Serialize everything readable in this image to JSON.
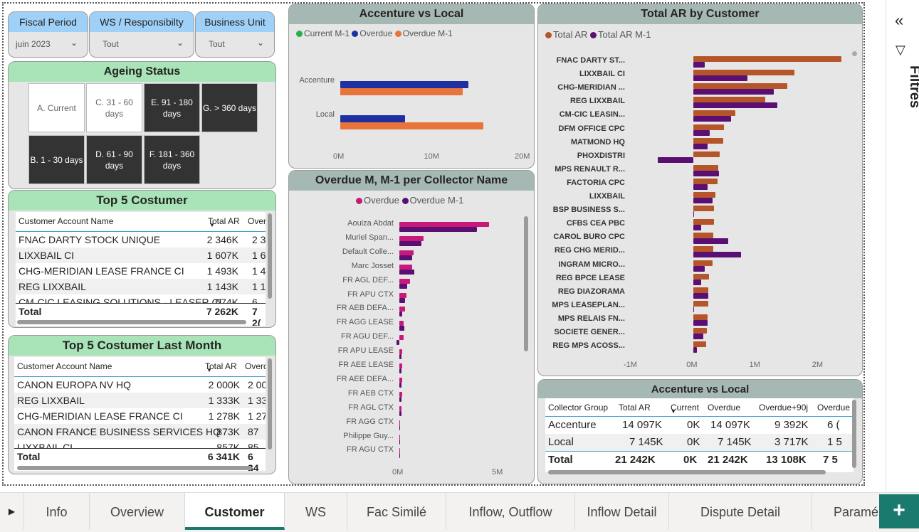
{
  "slicers": [
    {
      "label": "Fiscal Period",
      "value": "juin 2023"
    },
    {
      "label": "WS / Responsibilty",
      "value": "Tout"
    },
    {
      "label": "Business Unit",
      "value": "Tout"
    }
  ],
  "ageing": {
    "title": "Ageing Status",
    "tiles": [
      {
        "label": "A. Current",
        "style": "light"
      },
      {
        "label": "C. 31 - 60 days",
        "style": "light"
      },
      {
        "label": "E. 91 - 180 days",
        "style": "dark"
      },
      {
        "label": "G. > 360 days",
        "style": "dark"
      },
      {
        "label": "B. 1 - 30 days",
        "style": "dark"
      },
      {
        "label": "D. 61 - 90 days",
        "style": "dark"
      },
      {
        "label": "F. 181 - 360 days",
        "style": "dark"
      }
    ]
  },
  "top5": {
    "title": "Top 5 Costumer",
    "col_name": "Customer Account Name",
    "col_total": "Total AR",
    "col_over": "Over",
    "rows": [
      {
        "name": "FNAC DARTY STOCK UNIQUE",
        "total": "2 346K",
        "over": "2 3"
      },
      {
        "name": "LIXXBAIL CI",
        "total": "1 607K",
        "over": "1 6"
      },
      {
        "name": "CHG-MERIDIAN LEASE FRANCE CI",
        "total": "1 493K",
        "over": "1 4"
      },
      {
        "name": "REG LIXXBAIL",
        "total": "1 143K",
        "over": "1 1"
      },
      {
        "name": "CM-CIC LEASING SOLUTIONS - LEASER CI",
        "total": "674K",
        "over": "6"
      }
    ],
    "total_label": "Total",
    "total_value": "7 262K",
    "total_over": "7 2("
  },
  "top5_last": {
    "title": "Top 5 Costumer Last Month",
    "col_name": "Customer Account Name",
    "col_total": "Total AR",
    "col_over": "Overd",
    "rows": [
      {
        "name": "CANON EUROPA NV HQ",
        "total": "2 000K",
        "over": "2 00"
      },
      {
        "name": "REG LIXXBAIL",
        "total": "1 333K",
        "over": "1 33"
      },
      {
        "name": "CHG-MERIDIAN LEASE FRANCE CI",
        "total": "1 278K",
        "over": "1 27"
      },
      {
        "name": "CANON FRANCE BUSINESS SERVICES HQ",
        "total": "873K",
        "over": "87"
      },
      {
        "name": "LIXXBAIL CI",
        "total": "857K",
        "over": "85"
      }
    ],
    "total_label": "Total",
    "total_value": "6 341K",
    "total_over": "6 34"
  },
  "acc_chart": {
    "title": "Accenture vs Local",
    "legend": [
      {
        "name": "Current M-1",
        "color": "#23b14d"
      },
      {
        "name": "Overdue",
        "color": "#1f30a1"
      },
      {
        "name": "Overdue M-1",
        "color": "#e8743b"
      }
    ],
    "ticks": [
      "0M",
      "10M",
      "20M"
    ]
  },
  "collector_chart": {
    "title": "Overdue M, M-1 per Collector Name",
    "legend": [
      {
        "name": "Overdue",
        "color": "#c8197a"
      },
      {
        "name": "Overdue M-1",
        "color": "#5b0f73"
      }
    ],
    "ticks": [
      "0M",
      "5M"
    ]
  },
  "cust_chart": {
    "title": "Total AR by Customer",
    "legend": [
      {
        "name": "Total AR",
        "color": "#b5562a"
      },
      {
        "name": "Total AR M-1",
        "color": "#5b0f73"
      }
    ],
    "ticks": [
      "-1M",
      "0M",
      "1M",
      "2M"
    ]
  },
  "chart_data": [
    {
      "type": "bar",
      "title": "Accenture vs Local",
      "orientation": "horizontal",
      "categories": [
        "Accenture",
        "Local"
      ],
      "series": [
        {
          "name": "Current M-1",
          "values": [
            0,
            0
          ]
        },
        {
          "name": "Overdue",
          "values": [
            14.1,
            7.1
          ]
        },
        {
          "name": "Overdue M-1",
          "values": [
            13.5,
            15.8
          ]
        }
      ],
      "xlim": [
        0,
        20
      ],
      "x_ticks": [
        "0M",
        "10M",
        "20M"
      ]
    },
    {
      "type": "bar",
      "title": "Overdue M, M-1 per Collector Name",
      "orientation": "horizontal",
      "categories": [
        "Aouiza Abdat",
        "Muriel Span...",
        "Default Colle...",
        "Marc Josset",
        "FR AGL DEF...",
        "FR APU CTX",
        "FR AEB DEFA...",
        "FR AGG LEASE",
        "FR AGU DEF...",
        "FR APU LEASE",
        "FR AEE LEASE",
        "FR AEE DEFA...",
        "FR AEB CTX",
        "FR AGL CTX",
        "FR AGG CTX",
        "Philippe Guy...",
        "FR AGU CTX"
      ],
      "series": [
        {
          "name": "Overdue",
          "values": [
            4.5,
            1.2,
            0.7,
            0.65,
            0.55,
            0.35,
            0.3,
            0.2,
            0.2,
            0.15,
            0.15,
            0.15,
            0.15,
            0.12,
            0.05,
            0.05,
            0.02
          ]
        },
        {
          "name": "Overdue M-1",
          "values": [
            3.9,
            1.1,
            0.65,
            0.75,
            0.4,
            0.3,
            0.15,
            0.25,
            -0.15,
            0.1,
            0.1,
            0.1,
            0.12,
            0.1,
            0.05,
            0.05,
            0.02
          ]
        }
      ],
      "xlim": [
        0,
        5
      ],
      "x_ticks": [
        "0M",
        "5M"
      ]
    },
    {
      "type": "bar",
      "title": "Total AR by Customer",
      "orientation": "horizontal",
      "categories": [
        "FNAC DARTY ST...",
        "LIXXBAIL CI",
        "CHG-MERIDIAN ...",
        "REG LIXXBAIL",
        "CM-CIC LEASIN...",
        "DFM OFFICE CPC",
        "MATMOND HQ",
        "PHOXDISTRI",
        "MPS RENAULT R...",
        "FACTORIA CPC",
        "LIXXBAIL",
        "BSP BUSINESS S...",
        "CFBS CEA PBC",
        "CAROL BURO CPC",
        "REG CHG MERID...",
        "INGRAM MICRO...",
        "REG BPCE LEASE",
        "REG DIAZORAMA",
        "MPS LEASEPLAN...",
        "MPS RELAIS FN...",
        "SOCIETE GENER...",
        "REG MPS ACOSS..."
      ],
      "series": [
        {
          "name": "Total AR",
          "values": [
            2.35,
            1.61,
            1.49,
            1.14,
            0.67,
            0.49,
            0.47,
            0.42,
            0.39,
            0.38,
            0.35,
            0.33,
            0.33,
            0.32,
            0.31,
            0.3,
            0.25,
            0.24,
            0.23,
            0.22,
            0.21,
            0.2
          ]
        },
        {
          "name": "Total AR M-1",
          "values": [
            0.18,
            0.86,
            1.28,
            1.33,
            0.6,
            0.26,
            0.22,
            -0.57,
            0.41,
            0.22,
            0.3,
            0.01,
            0.12,
            0.55,
            0.76,
            0.18,
            0.12,
            0.24,
            0.01,
            0.22,
            0.16,
            0.05
          ]
        }
      ],
      "xlim": [
        -1,
        2.4
      ],
      "x_ticks": [
        "-1M",
        "0M",
        "1M",
        "2M"
      ]
    }
  ],
  "acc_table": {
    "title": "Accenture vs Local",
    "columns": [
      "Collector Group",
      "Total AR",
      "Current",
      "Overdue",
      "Overdue+90j",
      "Overdue"
    ],
    "rows": [
      [
        "Accenture",
        "14 097K",
        "0K",
        "14 097K",
        "9 392K",
        "6 ("
      ],
      [
        "Local",
        "7 145K",
        "0K",
        "7 145K",
        "3 717K",
        "1 5"
      ]
    ],
    "total": [
      "Total",
      "21 242K",
      "0K",
      "21 242K",
      "13 108K",
      "7 5"
    ]
  },
  "filters": {
    "label": "Filtres"
  },
  "tabs": [
    "Info",
    "Overview",
    "Customer",
    "WS",
    "Fac Similé",
    "Inflow, Outflow",
    "Inflow Detail",
    "Dispute Detail",
    "Paramé"
  ],
  "active_tab": "Customer",
  "add_label": "+"
}
